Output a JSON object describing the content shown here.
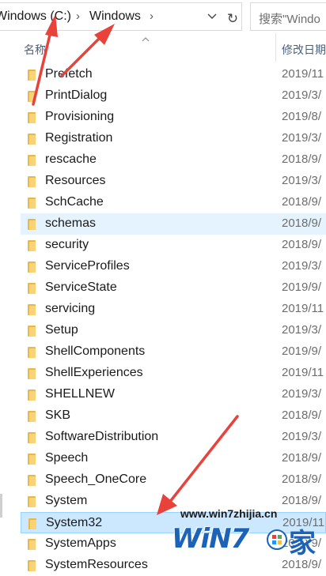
{
  "address": {
    "crumbs": [
      "Windows (C:)",
      "Windows"
    ],
    "separator": "›",
    "dropdown_glyph": "⌄",
    "refresh_glyph": "↻",
    "search_placeholder": "搜索\"Windo"
  },
  "columns": {
    "name": "名称",
    "date": "修改日期",
    "sort_glyph": "^"
  },
  "rows": [
    {
      "name": "Prefetch",
      "date": "2019/11"
    },
    {
      "name": "PrintDialog",
      "date": "2019/3/"
    },
    {
      "name": "Provisioning",
      "date": "2019/8/"
    },
    {
      "name": "Registration",
      "date": "2019/3/"
    },
    {
      "name": "rescache",
      "date": "2018/9/"
    },
    {
      "name": "Resources",
      "date": "2019/3/"
    },
    {
      "name": "SchCache",
      "date": "2018/9/"
    },
    {
      "name": "schemas",
      "date": "2018/9/",
      "state": "hover"
    },
    {
      "name": "security",
      "date": "2018/9/"
    },
    {
      "name": "ServiceProfiles",
      "date": "2019/3/"
    },
    {
      "name": "ServiceState",
      "date": "2019/9/"
    },
    {
      "name": "servicing",
      "date": "2019/11"
    },
    {
      "name": "Setup",
      "date": "2019/3/"
    },
    {
      "name": "ShellComponents",
      "date": "2019/9/"
    },
    {
      "name": "ShellExperiences",
      "date": "2019/11"
    },
    {
      "name": "SHELLNEW",
      "date": "2019/3/"
    },
    {
      "name": "SKB",
      "date": "2018/9/"
    },
    {
      "name": "SoftwareDistribution",
      "date": "2019/3/"
    },
    {
      "name": "Speech",
      "date": "2018/9/"
    },
    {
      "name": "Speech_OneCore",
      "date": "2018/9/"
    },
    {
      "name": "System",
      "date": "2018/9/"
    },
    {
      "name": "System32",
      "date": "2019/11",
      "state": "selected"
    },
    {
      "name": "SystemApps",
      "date": "2019/9/"
    },
    {
      "name": "SystemResources",
      "date": "2018/9/"
    }
  ],
  "watermark": {
    "url": "www.win7zhijia.cn",
    "logo_text": "WiN7",
    "logo_char": "家"
  },
  "colors": {
    "arrow": "#e8423a",
    "folder": "#f8d477",
    "selected": "#cce8ff",
    "hover": "#e5f3ff",
    "logo": "#1b63b8"
  }
}
